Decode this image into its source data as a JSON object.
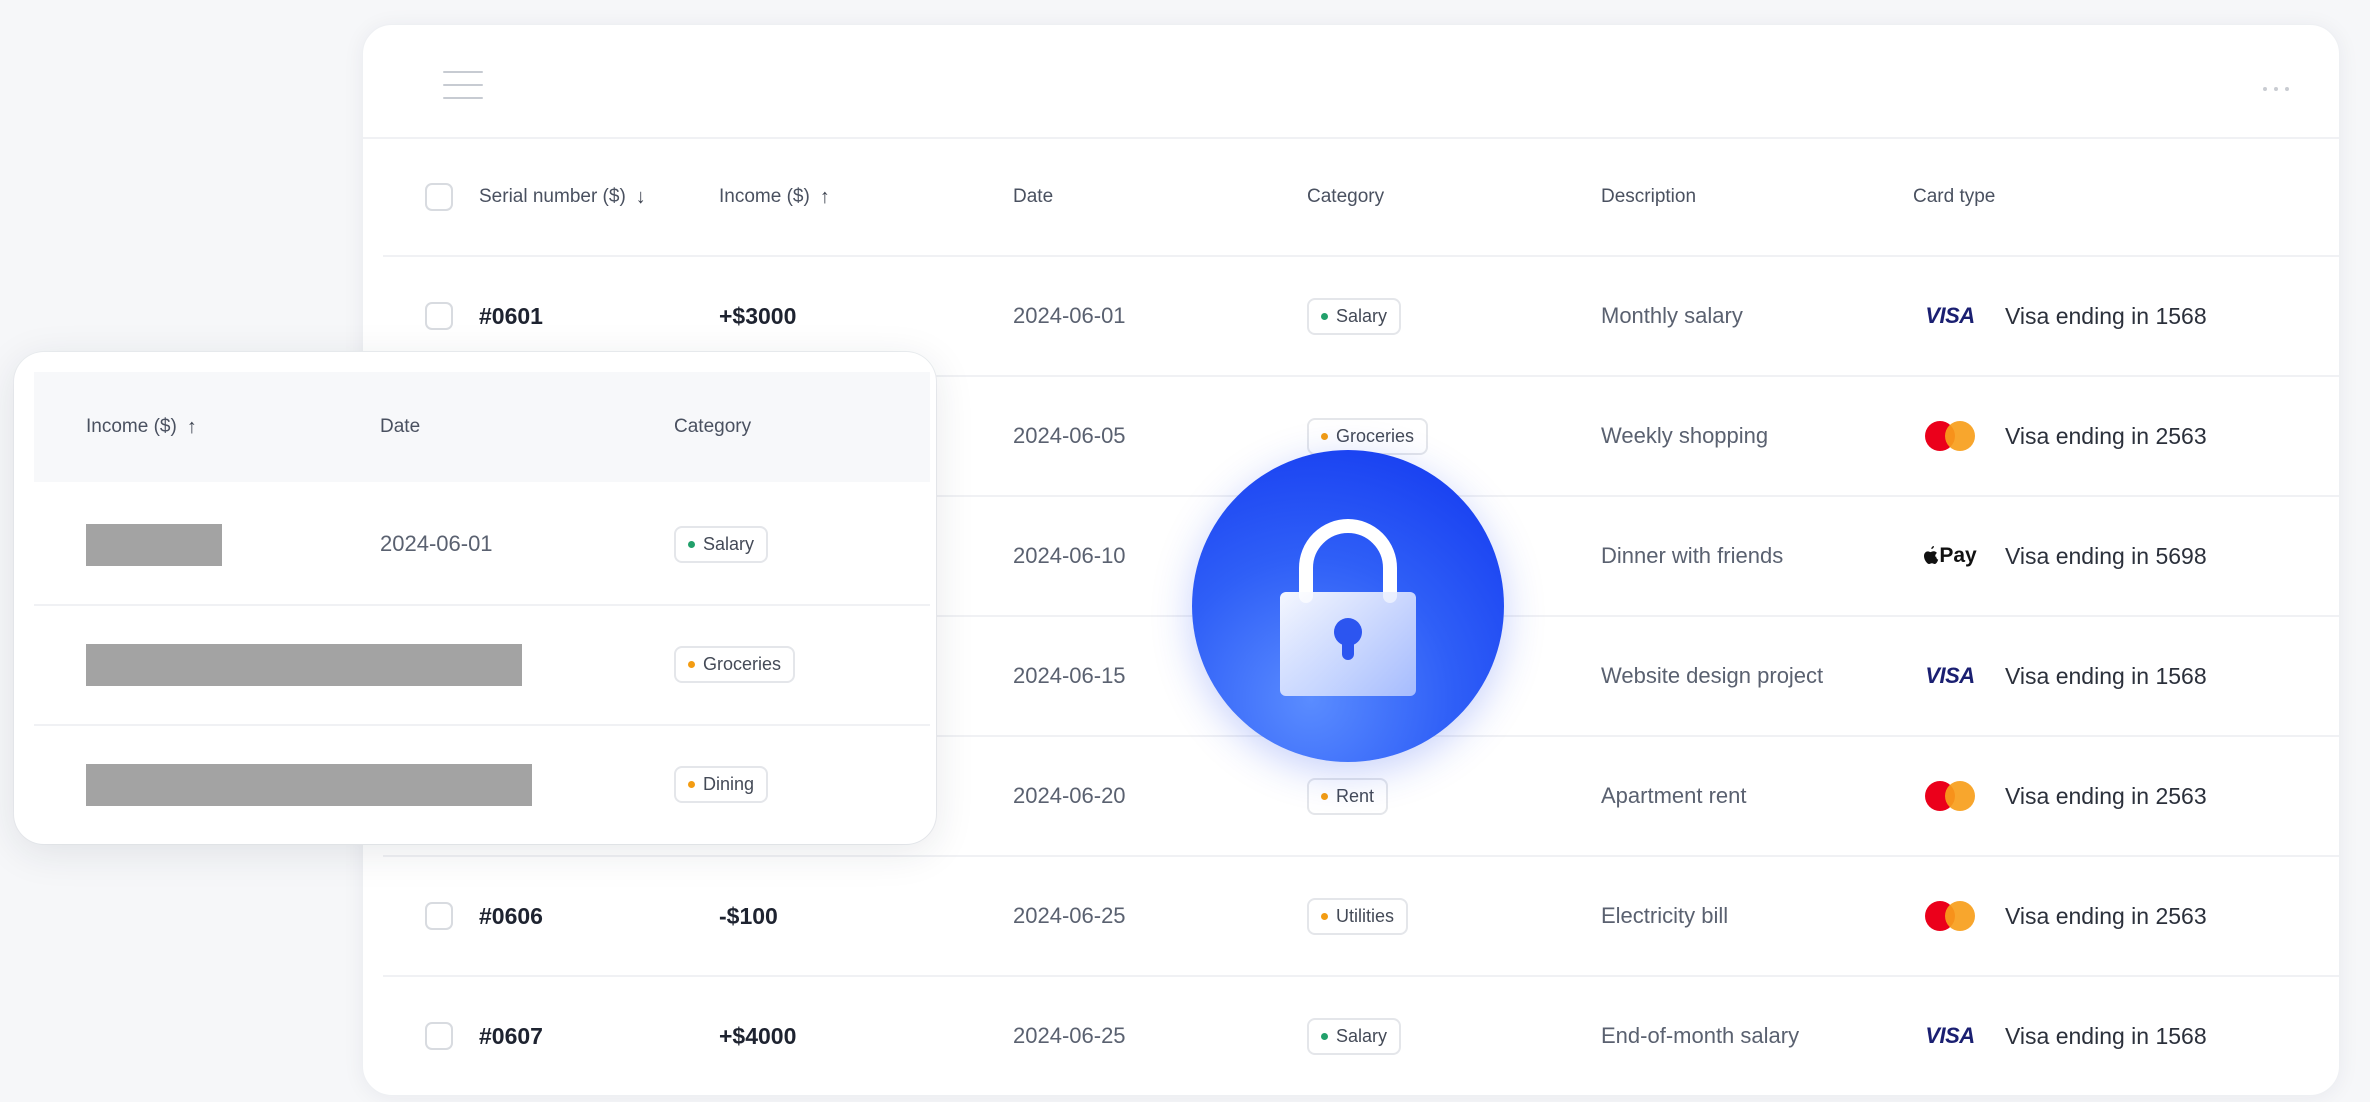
{
  "table": {
    "columns": {
      "serial": "Serial number ($)",
      "income": "Income ($)",
      "date": "Date",
      "category": "Category",
      "description": "Description",
      "card_type": "Card type"
    },
    "rows": [
      {
        "serial": "#0601",
        "amount": "+$3000",
        "date": "2024-06-01",
        "category": "Salary",
        "category_color": "#22a06b",
        "description": "Monthly salary",
        "card_logo": "visa",
        "card_logo_text": "VISA",
        "card": "Visa ending in 1568"
      },
      {
        "serial": "",
        "amount": "",
        "date": "2024-06-05",
        "category": "Groceries",
        "category_color": "#f39c12",
        "description": "Weekly shopping",
        "card_logo": "mastercard",
        "card_logo_text": "",
        "card": "Visa ending in 2563"
      },
      {
        "serial": "",
        "amount": "",
        "date": "2024-06-10",
        "category": "",
        "category_color": "",
        "description": "Dinner with friends",
        "card_logo": "apple-pay",
        "card_logo_text": "Pay",
        "card": "Visa ending in 5698"
      },
      {
        "serial": "",
        "amount": "",
        "date": "2024-06-15",
        "category": "",
        "category_color": "",
        "description": "Website design project",
        "card_logo": "visa",
        "card_logo_text": "VISA",
        "card": "Visa ending in 1568"
      },
      {
        "serial": "",
        "amount": "",
        "date": "2024-06-20",
        "category": "Rent",
        "category_color": "#f39c12",
        "description": "Apartment rent",
        "card_logo": "mastercard",
        "card_logo_text": "",
        "card": "Visa ending in 2563"
      },
      {
        "serial": "#0606",
        "amount": "-$100",
        "date": "2024-06-25",
        "category": "Utilities",
        "category_color": "#f39c12",
        "description": "Electricity bill",
        "card_logo": "mastercard",
        "card_logo_text": "",
        "card": "Visa ending in 2563"
      },
      {
        "serial": "#0607",
        "amount": "+$4000",
        "date": "2024-06-25",
        "category": "Salary",
        "category_color": "#22a06b",
        "description": "End-of-month salary",
        "card_logo": "visa",
        "card_logo_text": "VISA",
        "card": "Visa ending in 1568"
      }
    ]
  },
  "float_card": {
    "columns": {
      "income": "Income ($)",
      "date": "Date",
      "category": "Category"
    },
    "rows": [
      {
        "date": "2024-06-01",
        "category": "Salary",
        "category_color": "#22a06b"
      },
      {
        "date": "",
        "category": "Groceries",
        "category_color": "#f39c12"
      },
      {
        "date": "",
        "category": "Dining",
        "category_color": "#f39c12"
      }
    ]
  },
  "icons": {
    "sort_down": "↓",
    "sort_up": "↑",
    "menu": "menu-icon",
    "more": "more-icon",
    "lock": "lock-icon"
  }
}
